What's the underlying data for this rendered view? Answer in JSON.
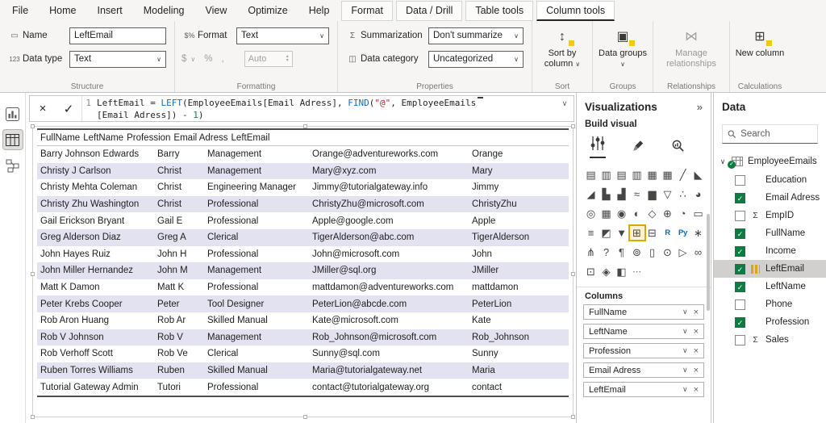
{
  "menubar": {
    "items": [
      {
        "label": "File"
      },
      {
        "label": "Home"
      },
      {
        "label": "Insert"
      },
      {
        "label": "Modeling"
      },
      {
        "label": "View"
      },
      {
        "label": "Optimize"
      },
      {
        "label": "Help"
      }
    ],
    "contextual": [
      {
        "label": "Format",
        "cls": ""
      },
      {
        "label": "Data / Drill",
        "cls": ""
      },
      {
        "label": "Table tools",
        "cls": ""
      },
      {
        "label": "Column tools",
        "cls": "active"
      }
    ]
  },
  "ribbon": {
    "structure": {
      "group_label": "Structure",
      "name_label": "Name",
      "name_icon": "▭",
      "name_value": "LeftEmail",
      "datatype_label": "Data type",
      "datatype_icon": "123",
      "datatype_value": "Text"
    },
    "formatting": {
      "group_label": "Formatting",
      "format_label": "Format",
      "format_icon": "$%",
      "format_value": "Text",
      "currency_icon": "$",
      "percent_icon": "%",
      "comma_icon": ",",
      "auto_label": "Auto"
    },
    "properties": {
      "group_label": "Properties",
      "summarization_label": "Summarization",
      "summarization_icon": "Σ",
      "summarization_value": "Don't summarize",
      "category_label": "Data category",
      "category_icon": "◫",
      "category_value": "Uncategorized"
    },
    "sort": {
      "group_label": "Sort",
      "button_label": "Sort by column",
      "icon": "↕",
      "chevron": "∨"
    },
    "groups": {
      "group_label": "Groups",
      "button_label": "Data groups",
      "icon": "▣",
      "chevron": "∨"
    },
    "relationships": {
      "group_label": "Relationships",
      "button_label": "Manage relationships",
      "icon": "⋈"
    },
    "calculations": {
      "group_label": "Calculations",
      "button_label": "New column",
      "icon": "⊞"
    }
  },
  "formula_bar": {
    "line_number": "1",
    "cancel_icon": "×",
    "commit_icon": "✓",
    "expand_icon": "∨",
    "tokens1": [
      {
        "t": "LeftEmail = ",
        "c": "tk-plain"
      },
      {
        "t": "LEFT",
        "c": "tk-fn"
      },
      {
        "t": "(EmployeeEmails[Email Adress], ",
        "c": "tk-plain"
      },
      {
        "t": "FIND",
        "c": "tk-fn"
      },
      {
        "t": "(",
        "c": "tk-plain"
      },
      {
        "t": "\"@\"",
        "c": "tk-str"
      },
      {
        "t": ", EmployeeEmails",
        "c": "tk-plain"
      }
    ],
    "tokens2": [
      {
        "t": "[Email Adress]) - ",
        "c": "tk-plain"
      },
      {
        "t": "1",
        "c": "tk-num"
      },
      {
        "t": ")",
        "c": "tk-plain"
      }
    ]
  },
  "table": {
    "columns": [
      "FullName",
      "LeftName",
      "Profession",
      "Email Adress",
      "LeftEmail"
    ],
    "rows": [
      [
        "Barry Johnson Edwards",
        "Barry",
        "Management",
        "Orange@adventureworks.com",
        "Orange"
      ],
      [
        "Christy J Carlson",
        "Christ",
        "Management",
        "Mary@xyz.com",
        "Mary"
      ],
      [
        "Christy Mehta Coleman",
        "Christ",
        "Engineering Manager",
        "Jimmy@tutorialgateway.info",
        "Jimmy"
      ],
      [
        "Christy Zhu Washington",
        "Christ",
        "Professional",
        "ChristyZhu@microsoft.com",
        "ChristyZhu"
      ],
      [
        "Gail Erickson Bryant",
        "Gail E",
        "Professional",
        "Apple@google.com",
        "Apple"
      ],
      [
        "Greg Alderson Diaz",
        "Greg A",
        "Clerical",
        "TigerAlderson@abc.com",
        "TigerAlderson"
      ],
      [
        "John Hayes Ruiz",
        "John H",
        "Professional",
        "John@microsoft.com",
        "John"
      ],
      [
        "John Miller Hernandez",
        "John M",
        "Management",
        "JMiller@sql.org",
        "JMiller"
      ],
      [
        "Matt K Damon",
        "Matt K",
        "Professional",
        "mattdamon@adventureworks.com",
        "mattdamon"
      ],
      [
        "Peter Krebs Cooper",
        "Peter",
        "Tool Designer",
        "PeterLion@abcde.com",
        "PeterLion"
      ],
      [
        "Rob Aron Huang",
        "Rob Ar",
        "Skilled Manual",
        "Kate@microsoft.com",
        "Kate"
      ],
      [
        "Rob V Johnson",
        "Rob V",
        "Management",
        "Rob_Johnson@microsoft.com",
        "Rob_Johnson"
      ],
      [
        "Rob Verhoff Scott",
        "Rob Ve",
        "Clerical",
        "Sunny@sql.com",
        "Sunny"
      ],
      [
        "Ruben Torres Williams",
        "Ruben",
        "Skilled Manual",
        "Maria@tutorialgateway.net",
        "Maria"
      ],
      [
        "Tutorial Gateway Admin",
        "Tutori",
        "Professional",
        "contact@tutorialgateway.org",
        "contact"
      ]
    ]
  },
  "visualizations": {
    "title": "Visualizations",
    "expand_icon": "»",
    "build_label": "Build visual",
    "columns_label": "Columns",
    "well_chevron": "∨",
    "well_remove": "×",
    "gallery": [
      {
        "n": "stacked-bar-chart-icon",
        "g": "▤",
        "cls": ""
      },
      {
        "n": "stacked-column-chart-icon",
        "g": "▥",
        "cls": ""
      },
      {
        "n": "clustered-bar-chart-icon",
        "g": "▤",
        "cls": ""
      },
      {
        "n": "clustered-column-chart-icon",
        "g": "▥",
        "cls": ""
      },
      {
        "n": "100-stacked-bar-chart-icon",
        "g": "▦",
        "cls": ""
      },
      {
        "n": "100-stacked-column-chart-icon",
        "g": "▦",
        "cls": ""
      },
      {
        "n": "line-chart-icon",
        "g": "╱",
        "cls": ""
      },
      {
        "n": "area-chart-icon",
        "g": "◣",
        "cls": ""
      },
      {
        "n": "stacked-area-chart-icon",
        "g": "◢",
        "cls": ""
      },
      {
        "n": "line-stacked-column-chart-icon",
        "g": "▙",
        "cls": ""
      },
      {
        "n": "line-clustered-column-chart-icon",
        "g": "▟",
        "cls": ""
      },
      {
        "n": "ribbon-chart-icon",
        "g": "≈",
        "cls": ""
      },
      {
        "n": "waterfall-chart-icon",
        "g": "▆",
        "cls": ""
      },
      {
        "n": "funnel-chart-icon",
        "g": "▽",
        "cls": ""
      },
      {
        "n": "scatter-chart-icon",
        "g": "∴",
        "cls": ""
      },
      {
        "n": "pie-chart-icon",
        "g": "◕",
        "cls": ""
      },
      {
        "n": "donut-chart-icon",
        "g": "◎",
        "cls": ""
      },
      {
        "n": "treemap-icon",
        "g": "▦",
        "cls": ""
      },
      {
        "n": "map-icon",
        "g": "◉",
        "cls": ""
      },
      {
        "n": "filled-map-icon",
        "g": "◐",
        "cls": ""
      },
      {
        "n": "shape-map-icon",
        "g": "◇",
        "cls": ""
      },
      {
        "n": "azure-map-icon",
        "g": "⊕",
        "cls": ""
      },
      {
        "n": "gauge-icon",
        "g": "◔",
        "cls": ""
      },
      {
        "n": "card-icon",
        "g": "▭",
        "cls": ""
      },
      {
        "n": "multi-row-card-icon",
        "g": "≡",
        "cls": ""
      },
      {
        "n": "kpi-icon",
        "g": "◩",
        "cls": ""
      },
      {
        "n": "slicer-icon",
        "g": "▼",
        "cls": ""
      },
      {
        "n": "table-icon",
        "g": "⊞",
        "cls": "selected"
      },
      {
        "n": "matrix-icon",
        "g": "⊟",
        "cls": ""
      },
      {
        "n": "r-script-icon",
        "g": "R",
        "cls": "txt"
      },
      {
        "n": "python-icon",
        "g": "Py",
        "cls": "txt"
      },
      {
        "n": "key-influencers-icon",
        "g": "∗",
        "cls": ""
      },
      {
        "n": "decomposition-tree-icon",
        "g": "⋔",
        "cls": ""
      },
      {
        "n": "qa-icon",
        "g": "?",
        "cls": ""
      },
      {
        "n": "smart-narrative-icon",
        "g": "¶",
        "cls": ""
      },
      {
        "n": "metrics-icon",
        "g": "⊚",
        "cls": ""
      },
      {
        "n": "paginated-report-icon",
        "g": "▯",
        "cls": ""
      },
      {
        "n": "arcgis-map-icon",
        "g": "⊙",
        "cls": ""
      },
      {
        "n": "power-apps-icon",
        "g": "▷",
        "cls": ""
      },
      {
        "n": "power-automate-icon",
        "g": "∞",
        "cls": ""
      },
      {
        "n": "custom-visual-icon",
        "g": "⊡",
        "cls": ""
      },
      {
        "n": "custom-visual-icon-2",
        "g": "◈",
        "cls": ""
      },
      {
        "n": "custom-visual-icon-3",
        "g": "◧",
        "cls": ""
      },
      {
        "n": "get-more-visuals-icon",
        "g": "⋯",
        "cls": "dots"
      }
    ],
    "wells": [
      {
        "label": "FullName"
      },
      {
        "label": "LeftName"
      },
      {
        "label": "Profession"
      },
      {
        "label": "Email Adress"
      },
      {
        "label": "LeftEmail"
      }
    ]
  },
  "data_panel": {
    "title": "Data",
    "search_placeholder": "Search",
    "tree": {
      "name": "EmployeeEmails",
      "chevron": "∨"
    },
    "fields": [
      {
        "label": "Education",
        "cls": "",
        "sigma": "",
        "sel": ""
      },
      {
        "label": "Email Adress",
        "cls": "checked",
        "sigma": "",
        "sel": ""
      },
      {
        "label": "EmpID",
        "cls": "",
        "sigma": "Σ",
        "sel": ""
      },
      {
        "label": "FullName",
        "cls": "checked",
        "sigma": "",
        "sel": ""
      },
      {
        "label": "Income",
        "cls": "checked",
        "sigma": "",
        "sel": ""
      },
      {
        "label": "LeftEmail",
        "cls": "checked",
        "sigma": "",
        "sel": "selected",
        "icon": "colic"
      },
      {
        "label": "LeftName",
        "cls": "checked",
        "sigma": "",
        "sel": ""
      },
      {
        "label": "Phone",
        "cls": "",
        "sigma": "",
        "sel": ""
      },
      {
        "label": "Profession",
        "cls": "checked",
        "sigma": "",
        "sel": ""
      },
      {
        "label": "Sales",
        "cls": "",
        "sigma": "Σ",
        "sel": ""
      }
    ]
  },
  "colors": {
    "accent": "#f2c811",
    "checked_green": "#0f7b44",
    "alt_row": "#e3e2f1",
    "selected_field": "#d2d0ce"
  }
}
